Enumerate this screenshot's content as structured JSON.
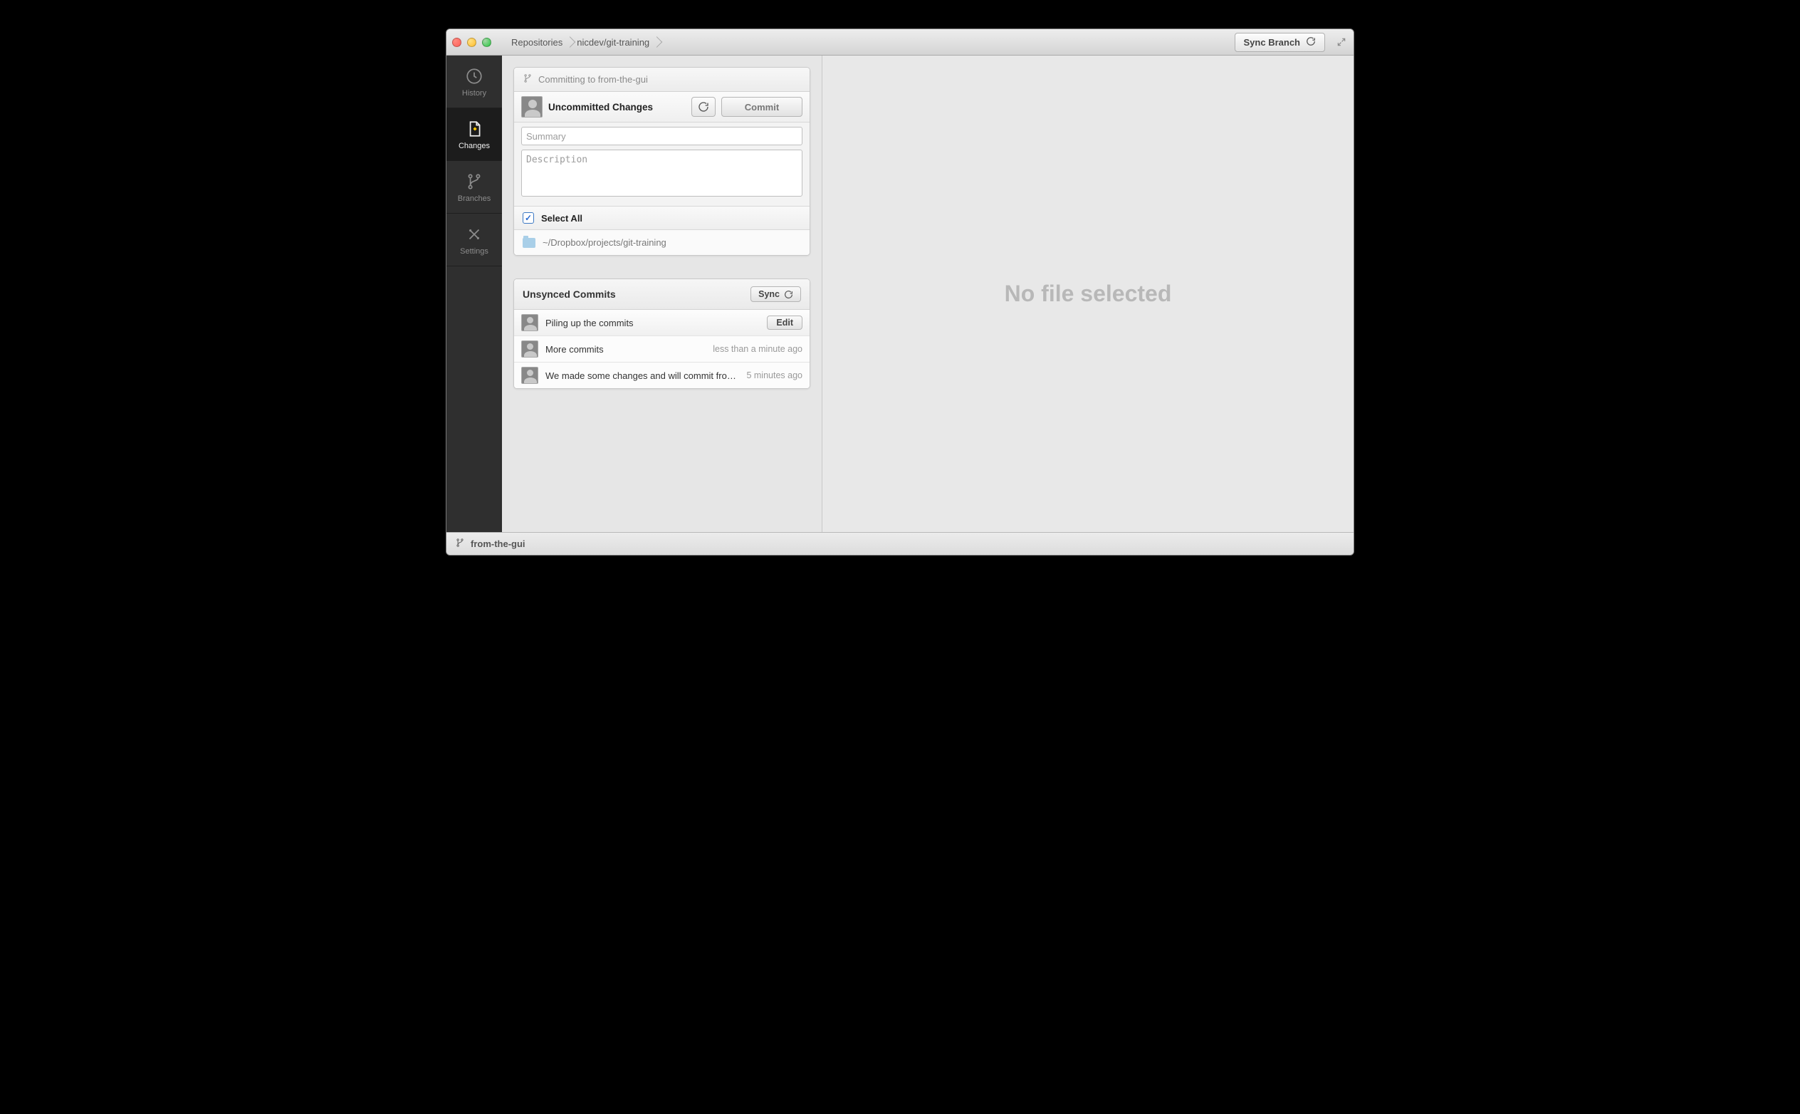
{
  "titlebar": {
    "breadcrumbs": [
      "Repositories",
      "nicdev/git-training"
    ],
    "sync_branch_label": "Sync Branch"
  },
  "sidebar": {
    "items": [
      {
        "id": "history",
        "label": "History"
      },
      {
        "id": "changes",
        "label": "Changes"
      },
      {
        "id": "branches",
        "label": "Branches"
      },
      {
        "id": "settings",
        "label": "Settings"
      }
    ],
    "active": "changes"
  },
  "commit_panel": {
    "branch_line": "Committing to from-the-gui",
    "title": "Uncommitted Changes",
    "commit_button": "Commit",
    "summary_placeholder": "Summary",
    "summary_value": "",
    "description_placeholder": "Description",
    "description_value": "",
    "select_all_label": "Select All",
    "select_all_checked": true,
    "project_path": "~/Dropbox/projects/git-training"
  },
  "unsynced_panel": {
    "title": "Unsynced Commits",
    "sync_label": "Sync",
    "edit_label": "Edit",
    "commits": [
      {
        "message": "Piling up the commits",
        "time": "",
        "selected": true
      },
      {
        "message": "More commits",
        "time": "less than a minute ago",
        "selected": false
      },
      {
        "message": "We made some changes and will commit from…",
        "time": "5 minutes ago",
        "selected": false
      }
    ]
  },
  "detail": {
    "empty_label": "No file selected"
  },
  "statusbar": {
    "branch": "from-the-gui"
  }
}
